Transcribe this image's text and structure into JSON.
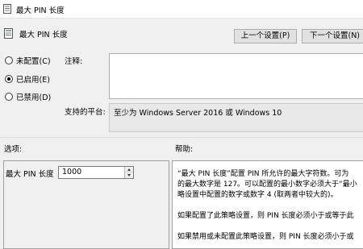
{
  "window": {
    "title": "最大 PIN 长度"
  },
  "header": {
    "title": "最大 PIN 长度",
    "prev_button": "上一个设置(P)",
    "next_button": "下一个设置(N)"
  },
  "state_options": {
    "not_configured": "未配置(C)",
    "enabled": "已启用(E)",
    "disabled": "已禁用(D)",
    "selected": "enabled"
  },
  "comment": {
    "label": "注释:",
    "value": ""
  },
  "platform": {
    "label": "支持的平台:",
    "value": "至少为 Windows Server 2016 或 Windows 10"
  },
  "sections": {
    "options_label": "选项:",
    "help_label": "帮助:"
  },
  "options": {
    "max_pin_label": "最大 PIN 长度",
    "max_pin_value": "1000"
  },
  "help": {
    "lines": [
      "“最大 PIN 长度”配置 PIN 所允许的最大字符数。可为",
      "的最大数字是 127。可以配置的最小数字必须大于“最小",
      "略设置中配置的数字或数字 4 (取两者中较大的)。",
      "",
      "如果配置了此策略设置，则 PIN 长度必须小于或等于此",
      "",
      "如果禁用或未配置此策略设置，则 PIN 长度必须小于或"
    ]
  }
}
